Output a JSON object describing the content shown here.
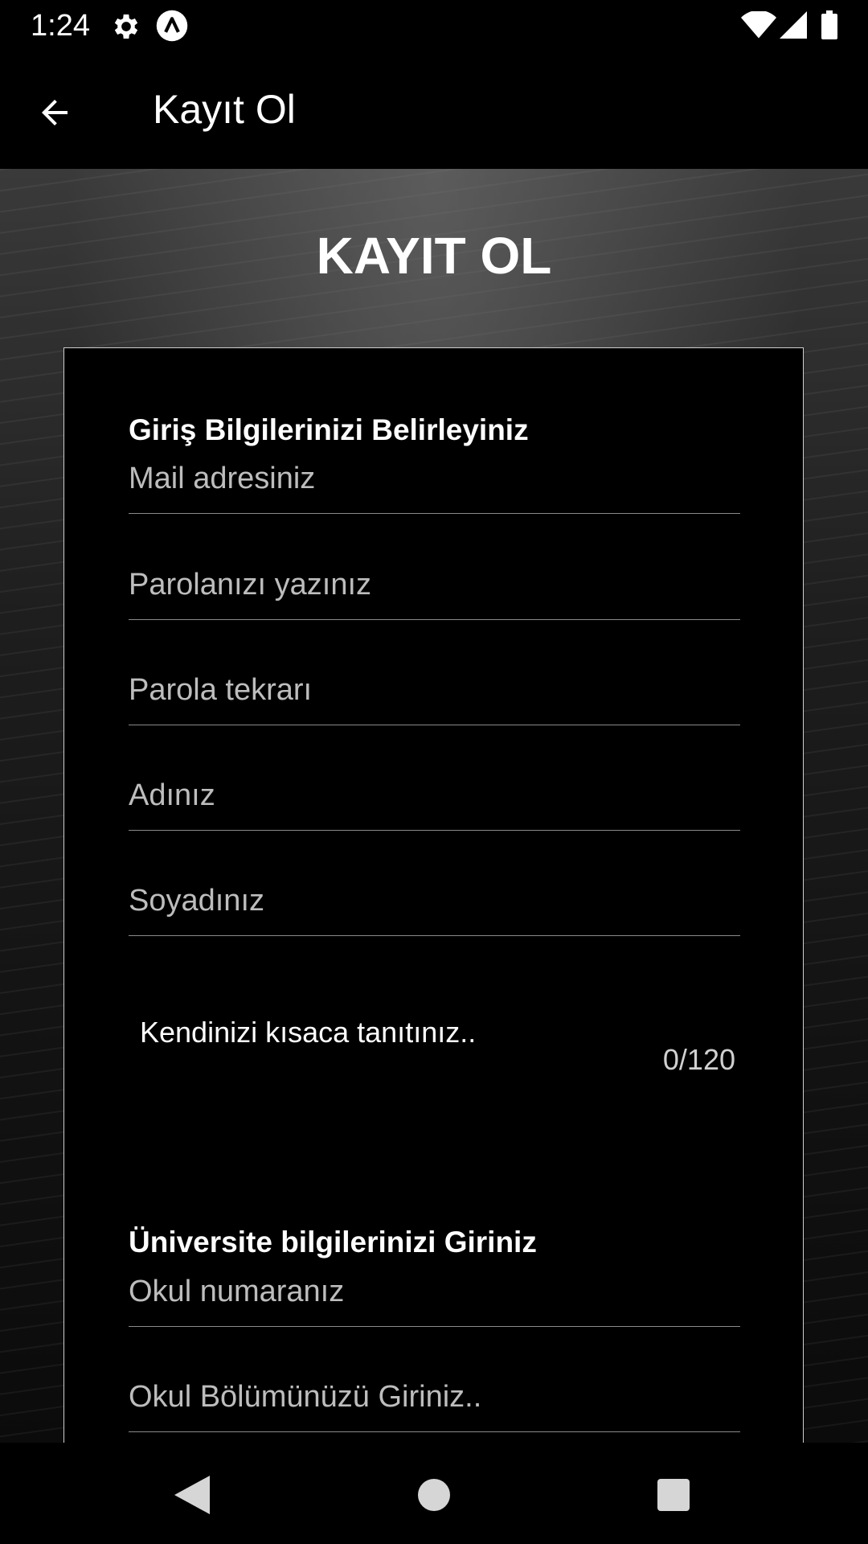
{
  "status_bar": {
    "time": "1:24",
    "icons": [
      "gear-icon",
      "app-icon",
      "wifi-icon",
      "signal-icon",
      "battery-icon"
    ]
  },
  "app_bar": {
    "title": "Kayıt Ol",
    "back_icon": "arrow-back-icon"
  },
  "page": {
    "heading": "KAYIT OL"
  },
  "form": {
    "login_section_title": "Giriş Bilgilerinizi Belirleyiniz",
    "email_placeholder": "Mail adresiniz",
    "password_placeholder": "Parolanızı yazınız",
    "password_repeat_placeholder": "Parola tekrarı",
    "first_name_placeholder": "Adınız",
    "last_name_placeholder": "Soyadınız",
    "bio_placeholder": "Kendinizi kısaca tanıtınız..",
    "bio_counter": "0/120",
    "university_section_title": "Üniversite bilgilerinizi Giriniz",
    "student_number_placeholder": "Okul numaranız",
    "department_placeholder": "Okul Bölümünüzü Giriniz.."
  },
  "nav_bar": {
    "buttons": [
      "back-triangle-icon",
      "home-circle-icon",
      "recents-square-icon"
    ]
  },
  "colors": {
    "background": "#000000",
    "text": "#ffffff",
    "placeholder": "#bdbdbd",
    "divider": "#8a8a8a",
    "card_border": "#cfcfcf"
  }
}
